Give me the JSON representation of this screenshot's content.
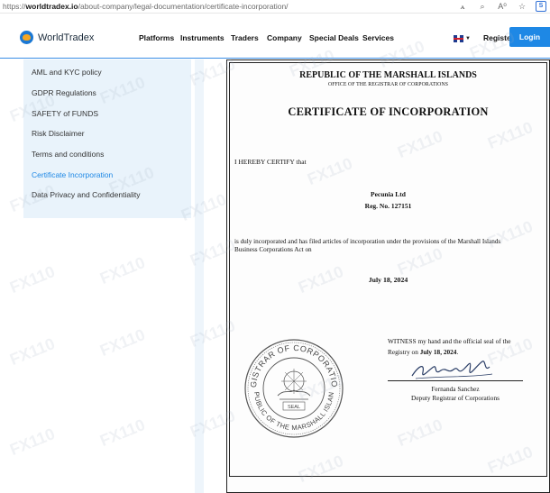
{
  "browser": {
    "url_prefix": "https://",
    "url_domain": "worldtradex.io",
    "url_path": "/about-company/legal-documentation/certificate-incorporation/",
    "tools": [
      "aa-icon",
      "zoom-icon",
      "read-aloud-icon",
      "favorite-icon",
      "sync-icon"
    ]
  },
  "header": {
    "brand": "WorldTradex",
    "nav": [
      "Platforms",
      "Instruments",
      "Traders",
      "Company",
      "Special Deals",
      "Services"
    ],
    "register": "Register",
    "login": "Login"
  },
  "sidebar": {
    "items": [
      {
        "label": "AML and KYC policy",
        "active": false
      },
      {
        "label": "GDPR Regulations",
        "active": false
      },
      {
        "label": "SAFETY of FUNDS",
        "active": false
      },
      {
        "label": "Risk Disclaimer",
        "active": false
      },
      {
        "label": "Terms and conditions",
        "active": false
      },
      {
        "label": "Certificate Incorporation",
        "active": true
      },
      {
        "label": "Data Privacy and Confidentiality",
        "active": false
      }
    ]
  },
  "certificate": {
    "republic": "REPUBLIC OF THE MARSHALL ISLANDS",
    "office": "OFFICE OF THE REGISTRAR OF CORPORATIONS",
    "title": "CERTIFICATE OF INCORPORATION",
    "certify": "I HEREBY CERTIFY that",
    "company": "Pecunia Ltd",
    "reg_no": "Reg. No.  127151",
    "body": "is duly incorporated and has filed articles of incorporation under the provisions of the Marshall Islands Business Corporations Act on",
    "date": "July 18, 2024",
    "witness_1": "WITNESS my hand and the official seal of the",
    "witness_2": "Registry on ",
    "witness_date": "July 18, 2024",
    "witness_end": ".",
    "signer_name": "Fernanda Sanchez",
    "signer_title": "Deputy Registrar of Corporations",
    "seal_text_top": "REGISTRAR OF CORPORATIONS",
    "seal_text_bottom": "REPUBLIC OF THE MARSHALL ISLANDS",
    "seal_center": "SEAL"
  },
  "watermark": "110"
}
